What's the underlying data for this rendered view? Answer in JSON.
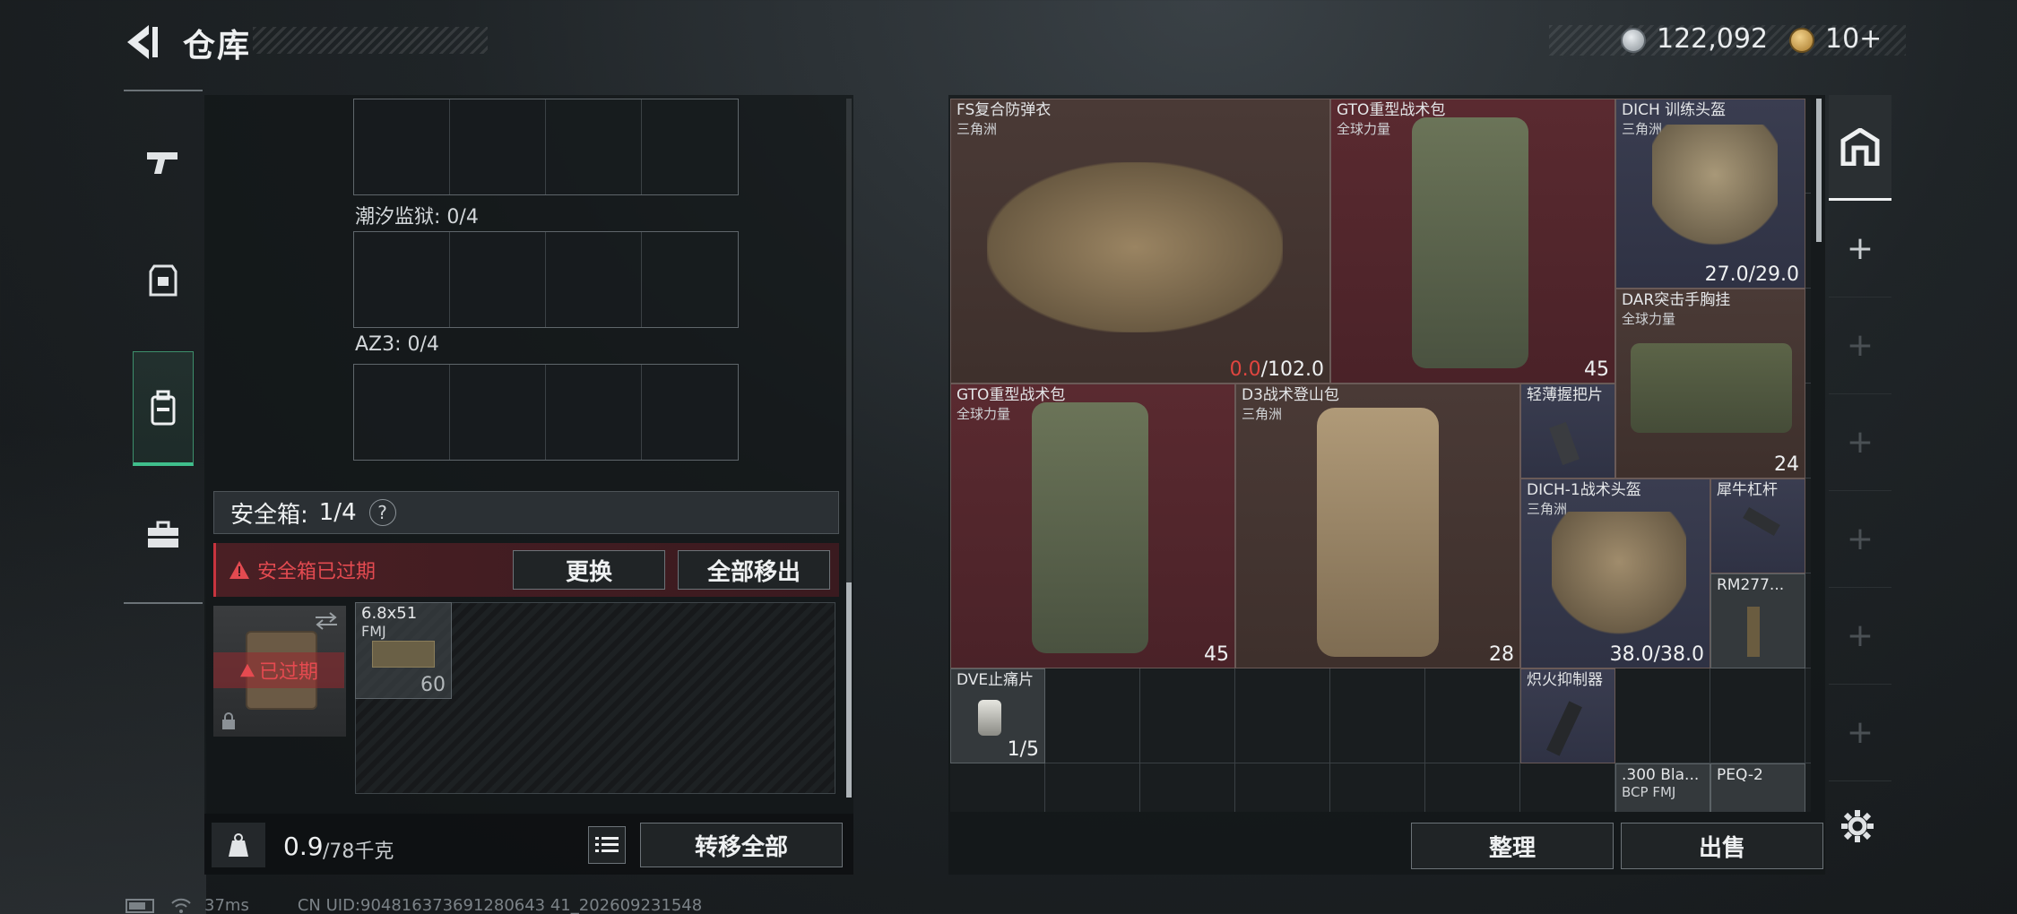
{
  "header": {
    "title": "仓库",
    "currency1": "122,092",
    "currency2": "10+"
  },
  "nav": [
    "pistol-icon",
    "armor-icon",
    "backpack-icon",
    "briefcase-icon"
  ],
  "left": {
    "section1": "潮汐监狱: 0/4",
    "section2": "AZ3: 0/4",
    "safe_label": "安全箱:",
    "safe_value": "1/4",
    "help": "?",
    "warn": "安全箱已过期",
    "btn_replace": "更换",
    "btn_move_all": "全部移出",
    "case_badge": "已过期",
    "ammo_name": "6.8x51",
    "ammo_sub": "FMJ",
    "ammo_count": "60",
    "weight_cur": "0.9",
    "weight_max": "/78千克",
    "btn_transfer": "转移全部"
  },
  "right": {
    "items": [
      {
        "name": "FS复合防弹衣",
        "sub": "三角洲",
        "val_red": "0.0",
        "val": "/102.0"
      },
      {
        "name": "GTO重型战术包",
        "sub": "全球力量",
        "val": "45"
      },
      {
        "name": "DICH 训练头盔",
        "sub": "三角洲",
        "val": "27.0/29.0"
      },
      {
        "name": "DAR突击手胸挂",
        "sub": "全球力量",
        "val": "24"
      },
      {
        "name": "GTO重型战术包",
        "sub": "全球力量",
        "val": "45"
      },
      {
        "name": "D3战术登山包",
        "sub": "三角洲",
        "val": "28"
      },
      {
        "name": "轻薄握把片",
        "sub": "",
        "val": ""
      },
      {
        "name": "DICH-1战术头盔",
        "sub": "三角洲",
        "val": "38.0/38.0"
      },
      {
        "name": "犀牛杠杆",
        "sub": "",
        "val": ""
      },
      {
        "name": "RM277...",
        "sub": "",
        "val": ""
      },
      {
        "name": "DVE止痛片",
        "sub": "",
        "val": "1/5"
      },
      {
        "name": "炽火抑制器",
        "sub": "",
        "val": ""
      },
      {
        "name": ".300 Bla...",
        "sub": "BCP FMJ",
        "val": ""
      },
      {
        "name": "PEQ-2",
        "sub": "",
        "val": ""
      }
    ],
    "btn_sort": "整理",
    "btn_sell": "出售"
  },
  "footer": {
    "ping": "37ms",
    "uid": "CN UID:904816373691280643 41_202609231548"
  }
}
